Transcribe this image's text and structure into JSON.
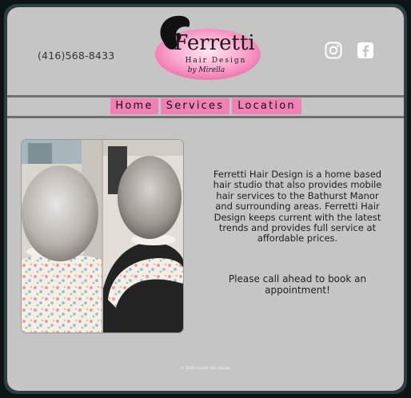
{
  "header": {
    "phone": "(416)568-8433",
    "logo": {
      "name": "Ferretti",
      "tagline": "Hair Design",
      "byline": "by Mirella"
    },
    "social": [
      {
        "icon": "instagram-icon"
      },
      {
        "icon": "facebook-icon"
      }
    ]
  },
  "nav": {
    "items": [
      {
        "label": "Home"
      },
      {
        "label": "Services"
      },
      {
        "label": "Location"
      }
    ]
  },
  "main": {
    "about": "Ferretti Hair Design is a home based hair studio that also provides mobile hair services to the Bathurst Manor and surrounding areas. Ferretti Hair Design keeps current with the latest trends and provides full service at affordable prices.",
    "cta": "Please call ahead to book an appointment!"
  },
  "footer": {
    "copyright": "© 2018 Ferretti Hair Design"
  },
  "colors": {
    "accent": "#f181b4",
    "panel": "#c5c5c5",
    "frame": "#2e3f44"
  }
}
